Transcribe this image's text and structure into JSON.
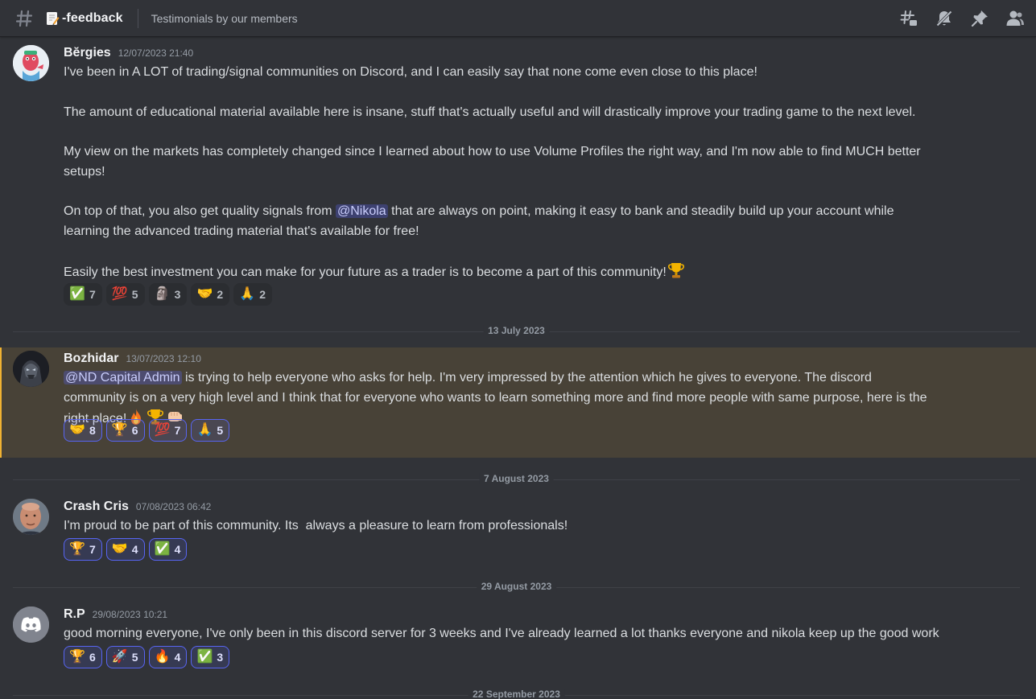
{
  "header": {
    "channel_name": "-feedback",
    "topic": "Testimonials by our members",
    "icons": [
      "threads-icon",
      "notification-muted-icon",
      "pin-icon",
      "member-list-icon"
    ]
  },
  "messages": [
    {
      "author": "Bĕrgies",
      "timestamp": "12/07/2023 21:40",
      "paragraphs": [
        "I've been in A LOT of trading/signal communities on Discord, and I can easily say that none come even close to this place!",
        "The amount of educational material available here is insane, stuff that's actually useful and will drastically improve your trading game to the next level.",
        "My view on the markets has completely changed since I learned about how to use Volume Profiles the right way, and I'm now able to find MUCH better",
        "setups!",
        "On top of that, you also get quality signals from",
        "@Nikola",
        "that are always on point, making it easy to bank and steadily build up your account while",
        "learning the advanced trading material that's available for free!",
        "Easily the best investment you can make for your future as a trader is to become a part of this community!"
      ],
      "reactions": [
        {
          "emoji": "✅",
          "count": "7"
        },
        {
          "emoji": "💯",
          "count": "5"
        },
        {
          "emoji": "🗿",
          "count": "3"
        },
        {
          "emoji": "🤝",
          "count": "2"
        },
        {
          "emoji": "🙏",
          "count": "2"
        }
      ]
    },
    {
      "author": "Bozhidar",
      "timestamp": "13/07/2023 12:10",
      "mention": "@ND Capital Admin",
      "line1": "is trying to help everyone who asks for help. I'm very impressed by the attention which he gives to everyone. The discord",
      "line2": "community is on a very high level and I think that for everyone who wants to learn something more and find more people with same purpose, here is the",
      "line3": "right place!",
      "reactions": [
        {
          "emoji": "🤝",
          "count": "8"
        },
        {
          "emoji": "🏆",
          "count": "6"
        },
        {
          "emoji": "💯",
          "count": "7"
        },
        {
          "emoji": "🙏",
          "count": "5"
        }
      ]
    },
    {
      "author": "Crash Cris",
      "timestamp": "07/08/2023 06:42",
      "text": "I'm proud to be part of this community. Its  always a pleasure to learn from professionals!",
      "reactions": [
        {
          "emoji": "🏆",
          "count": "7"
        },
        {
          "emoji": "🤝",
          "count": "4"
        },
        {
          "emoji": "✅",
          "count": "4"
        }
      ]
    },
    {
      "author": "R.P",
      "timestamp": "29/08/2023 10:21",
      "text": "good morning everyone, I've only been in this discord server for 3 weeks and I've already learned a lot thanks everyone and nikola keep up the good work",
      "reactions": [
        {
          "emoji": "🏆",
          "count": "6"
        },
        {
          "emoji": "🚀",
          "count": "5"
        },
        {
          "emoji": "🔥",
          "count": "4"
        },
        {
          "emoji": "✅",
          "count": "3"
        }
      ]
    }
  ],
  "date_separators": [
    "13 July 2023",
    "7 August 2023",
    "29 August 2023",
    "22 September 2023"
  ],
  "colors": {
    "background": "#313338",
    "mention_bg": "#3c4270",
    "highlight_border": "#f0b232",
    "reaction_active_border": "#5865f2"
  }
}
